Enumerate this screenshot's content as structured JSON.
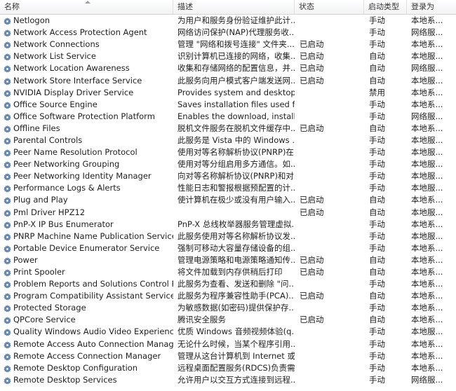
{
  "columns": {
    "name": "名称",
    "description": "描述",
    "status": "状态",
    "startup_type": "启动类型",
    "log_on_as": "登录为"
  },
  "icon": "gear-icon",
  "services": [
    {
      "name": "Netlogon",
      "description": "为用户和服务身份验证维护此计...",
      "status": "",
      "startup": "手动",
      "logon": "本地系..."
    },
    {
      "name": "Network Access Protection Agent",
      "description": "网络访问保护(NAP)代理服务收...",
      "status": "",
      "startup": "手动",
      "logon": "网络服..."
    },
    {
      "name": "Network Connections",
      "description": "管理 \"网络和拨号连接\" 文件夹...",
      "status": "已启动",
      "startup": "手动",
      "logon": "本地系..."
    },
    {
      "name": "Network List Service",
      "description": "识别计算机已连接的网络，收集...",
      "status": "已启动",
      "startup": "自动",
      "logon": "本地服..."
    },
    {
      "name": "Network Location Awareness",
      "description": "收集和存储网络的配置信息，并...",
      "status": "已启动",
      "startup": "自动",
      "logon": "网络服..."
    },
    {
      "name": "Network Store Interface Service",
      "description": "此服务向用户模式客户端发送网...",
      "status": "已启动",
      "startup": "自动",
      "logon": "本地服..."
    },
    {
      "name": "NVIDIA Display Driver Service",
      "description": "Provides system and desktop ...",
      "status": "",
      "startup": "禁用",
      "logon": "本地系..."
    },
    {
      "name": "Office  Source Engine",
      "description": "Saves installation files used fo...",
      "status": "",
      "startup": "手动",
      "logon": "本地系..."
    },
    {
      "name": "Office Software Protection Platform",
      "description": "Enables the download, installa...",
      "status": "",
      "startup": "手动",
      "logon": "网络服..."
    },
    {
      "name": "Offline Files",
      "description": "脱机文件服务在脱机文件缓存中...",
      "status": "已启动",
      "startup": "自动",
      "logon": "本地系..."
    },
    {
      "name": "Parental Controls",
      "description": "此服务是 Vista 中的 Windows ...",
      "status": "",
      "startup": "手动",
      "logon": "本地服..."
    },
    {
      "name": "Peer Name Resolution Protocol",
      "description": "使用对等名称解析协议(PNRP)在 ...",
      "status": "",
      "startup": "手动",
      "logon": "本地服..."
    },
    {
      "name": "Peer Networking Grouping",
      "description": "使用对等分组启用多方通信。如...",
      "status": "",
      "startup": "手动",
      "logon": "本地服..."
    },
    {
      "name": "Peer Networking Identity Manager",
      "description": "向对等名称解析协议(PNRP)和对...",
      "status": "",
      "startup": "手动",
      "logon": "本地服..."
    },
    {
      "name": "Performance Logs & Alerts",
      "description": "性能日志和警报根据预配置的计...",
      "status": "",
      "startup": "手动",
      "logon": "本地服..."
    },
    {
      "name": "Plug and Play",
      "description": "使计算机在极少或没有用户输入...",
      "status": "已启动",
      "startup": "自动",
      "logon": "本地系..."
    },
    {
      "name": "Pml Driver HPZ12",
      "description": "",
      "status": "已启动",
      "startup": "自动",
      "logon": "本地服..."
    },
    {
      "name": "PnP-X IP Bus Enumerator",
      "description": "PnP-X 总线枚举器服务管理虚拟...",
      "status": "",
      "startup": "手动",
      "logon": "本地系..."
    },
    {
      "name": "PNRP Machine Name Publication Service",
      "description": "此服务使用对等名称解析协议发...",
      "status": "",
      "startup": "手动",
      "logon": "本地服..."
    },
    {
      "name": "Portable Device Enumerator Service",
      "description": "强制可移动大容量存储设备的组...",
      "status": "",
      "startup": "手动",
      "logon": "本地系..."
    },
    {
      "name": "Power",
      "description": "管理电源策略和电源策略通知传...",
      "status": "已启动",
      "startup": "自动",
      "logon": "本地系..."
    },
    {
      "name": "Print Spooler",
      "description": "将文件加载到内存供稍后打印",
      "status": "已启动",
      "startup": "自动",
      "logon": "本地系..."
    },
    {
      "name": "Problem Reports and Solutions Control Pa...",
      "description": "此服务为查看、发送和删除 \"问...",
      "status": "",
      "startup": "手动",
      "logon": "本地系..."
    },
    {
      "name": "Program Compatibility Assistant Service",
      "description": "此服务为程序兼容性助手(PCA)...",
      "status": "已启动",
      "startup": "自动",
      "logon": "本地系..."
    },
    {
      "name": "Protected Storage",
      "description": "为敏感数据(如密码)提供保护存...",
      "status": "",
      "startup": "手动",
      "logon": "本地系..."
    },
    {
      "name": "QPCore Service",
      "description": "腾讯安全服务",
      "status": "已启动",
      "startup": "自动",
      "logon": "本地系..."
    },
    {
      "name": "Quality Windows Audio Video Experience",
      "description": "优质 Windows 音频视频体验(q...",
      "status": "",
      "startup": "手动",
      "logon": "本地服..."
    },
    {
      "name": "Remote Access Auto Connection Manager",
      "description": "无论什么时候，当某个程序引用...",
      "status": "",
      "startup": "手动",
      "logon": "本地系..."
    },
    {
      "name": "Remote Access Connection Manager",
      "description": "管理从这台计算机到 Internet 或...",
      "status": "",
      "startup": "手动",
      "logon": "本地系..."
    },
    {
      "name": "Remote Desktop Configuration",
      "description": "远程桌面配置服务(RDCS)负责需...",
      "status": "",
      "startup": "手动",
      "logon": "本地系..."
    },
    {
      "name": "Remote Desktop Services",
      "description": "允许用户以交互方式连接到远程...",
      "status": "",
      "startup": "手动",
      "logon": "网络服..."
    }
  ]
}
